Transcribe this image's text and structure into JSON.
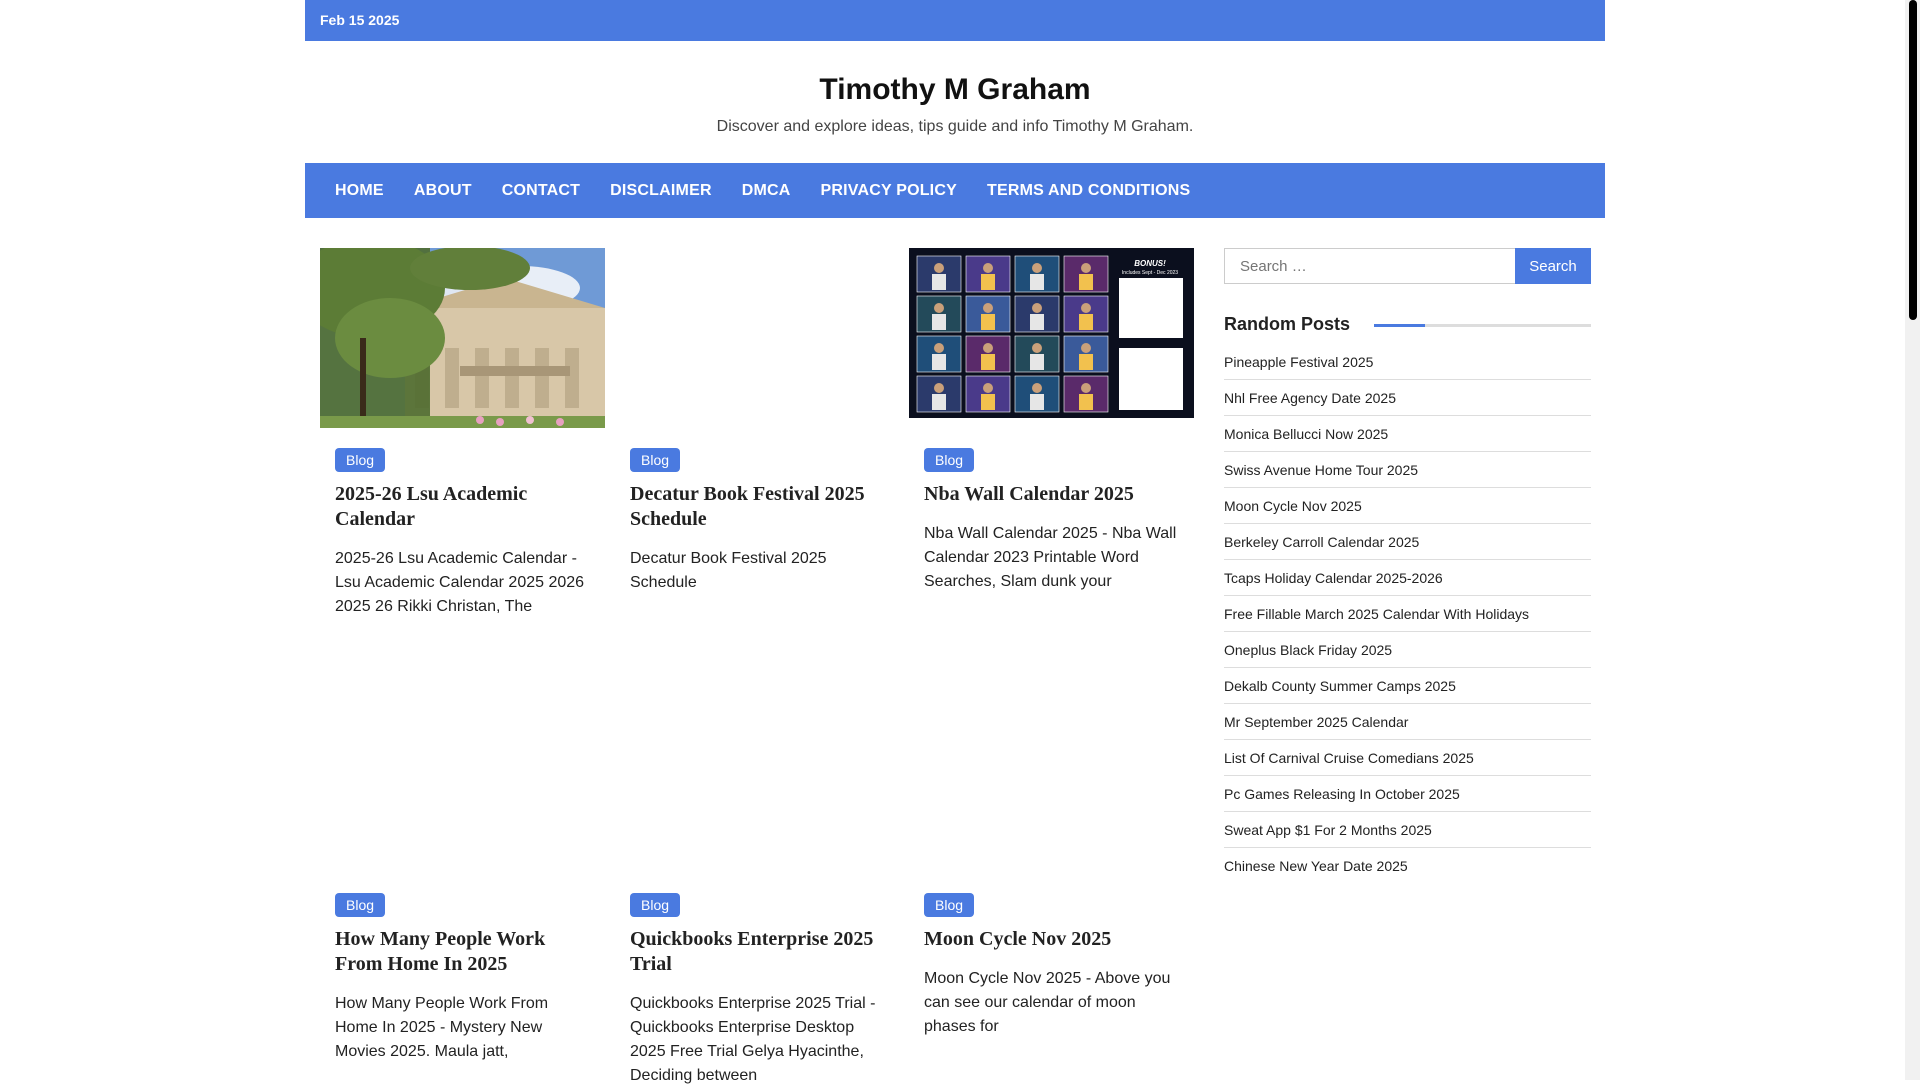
{
  "topbar": {
    "date": "Feb 15 2025"
  },
  "site": {
    "title": "Timothy M Graham",
    "description": "Discover and explore ideas, tips guide and info Timothy M Graham."
  },
  "nav": [
    "HOME",
    "ABOUT",
    "CONTACT",
    "DISCLAIMER",
    "DMCA",
    "PRIVACY POLICY",
    "TERMS AND CONDITIONS"
  ],
  "posts": [
    {
      "category": "Blog",
      "title": "2025-26 Lsu Academic Calendar",
      "excerpt": "2025-26 Lsu Academic Calendar - Lsu Academic Calendar 2025 2026 2025 26 Rikki Christan, The"
    },
    {
      "category": "Blog",
      "title": "Decatur Book Festival 2025 Schedule",
      "excerpt": "Decatur Book Festival 2025 Schedule"
    },
    {
      "category": "Blog",
      "title": "Nba Wall Calendar 2025",
      "excerpt": "Nba Wall Calendar 2025 - Nba Wall Calendar 2023 Printable Word Searches, Slam dunk your"
    },
    {
      "category": "Blog",
      "title": "How Many People Work From Home In 2025",
      "excerpt": "How Many People Work From Home In 2025 - Mystery New Movies 2025. Maula jatt,"
    },
    {
      "category": "Blog",
      "title": "Quickbooks Enterprise 2025 Trial",
      "excerpt": "Quickbooks Enterprise 2025 Trial - Quickbooks Enterprise Desktop 2025 Free Trial Gelya Hyacinthe, Deciding between"
    },
    {
      "category": "Blog",
      "title": "Moon Cycle Nov 2025",
      "excerpt": "Moon Cycle Nov 2025 - Above you can see our calendar of moon phases for"
    }
  ],
  "nba_image": {
    "badge_line1": "BONUS!",
    "badge_line2": "Includes Sept - Dec 2023"
  },
  "search": {
    "placeholder": "Search …",
    "button": "Search"
  },
  "sidebar": {
    "title": "Random Posts",
    "items": [
      "Pineapple Festival 2025",
      "Nhl Free Agency Date 2025",
      "Monica Bellucci Now 2025",
      "Swiss Avenue Home Tour 2025",
      "Moon Cycle Nov 2025",
      "Berkeley Carroll Calendar 2025",
      "Tcaps Holiday Calendar 2025-2026",
      "Free Fillable March 2025 Calendar With Holidays",
      "Oneplus Black Friday 2025",
      "Dekalb County Summer Camps 2025",
      "Mr September 2025 Calendar",
      "List Of Carnival Cruise Comedians 2025",
      "Pc Games Releasing In October 2025",
      "Sweat App $1 For 2 Months 2025",
      "Chinese New Year Date 2025"
    ]
  },
  "colors": {
    "accent": "#4a7ae0"
  }
}
